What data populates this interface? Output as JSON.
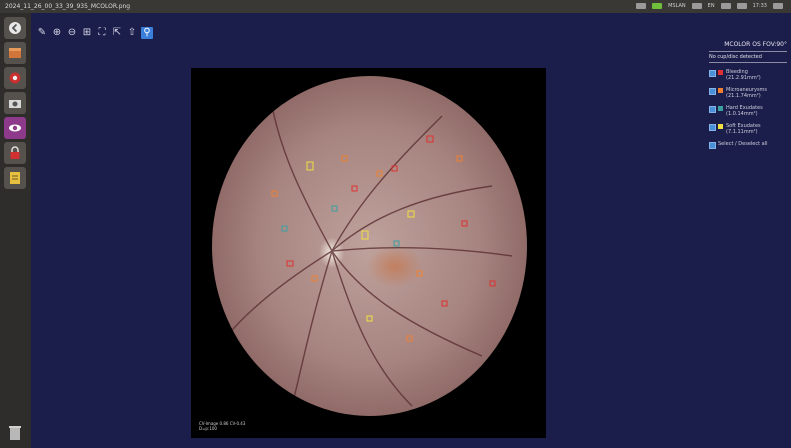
{
  "window": {
    "title": "2024_11_26_00_33_39_935_MCOLOR.png"
  },
  "tray": {
    "network": "MSLAN",
    "keyboard": "EN",
    "time": "17:33"
  },
  "launcher": {
    "items": [
      {
        "name": "back-icon"
      },
      {
        "name": "file-manager-icon"
      },
      {
        "name": "settings-icon"
      },
      {
        "name": "camera-icon"
      },
      {
        "name": "eye-app-icon",
        "active": true
      },
      {
        "name": "lock-icon"
      },
      {
        "name": "document-icon"
      }
    ],
    "trash": "trash-icon"
  },
  "toolbar": {
    "tools": [
      {
        "name": "edit-icon",
        "glyph": "✎"
      },
      {
        "name": "zoom-in-icon",
        "glyph": "⊕"
      },
      {
        "name": "zoom-out-icon",
        "glyph": "⊖"
      },
      {
        "name": "grid-icon",
        "glyph": "⊞"
      },
      {
        "name": "crop-icon",
        "glyph": "⛶"
      },
      {
        "name": "export-icon",
        "glyph": "⇱"
      },
      {
        "name": "upload-icon",
        "glyph": "⇧"
      },
      {
        "name": "search-icon",
        "glyph": "⚲",
        "selected": true
      }
    ]
  },
  "app": {
    "title": "MCOLOR OS FOV:90°"
  },
  "image": {
    "caption_line1": "CV-Image 0.86 CV-0.43",
    "caption_line2": "D=p:100"
  },
  "panel": {
    "status": "No cup/disc detected",
    "legend": [
      {
        "label": "Bleeding",
        "value": "(21.2.91mm²)",
        "color": "#e03030"
      },
      {
        "label": "Microaneurysms",
        "value": "(21.1.74mm²)",
        "color": "#f08030"
      },
      {
        "label": "Hard Exudates",
        "value": "(1.0.14mm²)",
        "color": "#3aa0a0"
      },
      {
        "label": "Soft Exudates",
        "value": "(7.1.11mm²)",
        "color": "#f0e040"
      }
    ],
    "select_all": "Select / Deselect all"
  }
}
